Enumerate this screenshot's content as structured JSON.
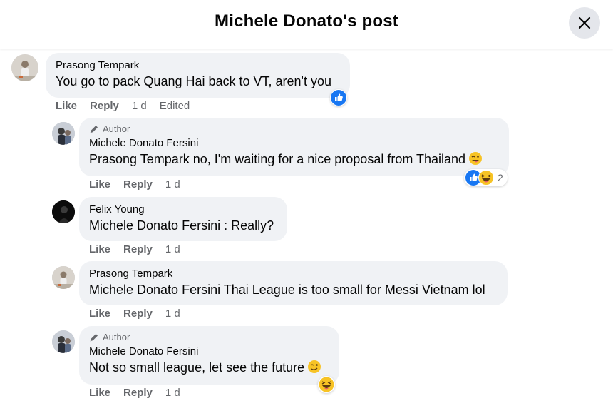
{
  "header": {
    "title": "Michele Donato's post"
  },
  "comments": [
    {
      "name": "Prasong Tempark",
      "text": "You go to pack Quang Hai back to VT, aren't you",
      "actions": {
        "like": "Like",
        "reply": "Reply",
        "time": "1 d",
        "edited": "Edited"
      }
    },
    {
      "author_tag": "Author",
      "name": "Michele Donato Fersini",
      "mention": "Prasong Tempark",
      "text": " no, I'm waiting for a nice proposal from Thailand",
      "reaction_count": "2",
      "actions": {
        "like": "Like",
        "reply": "Reply",
        "time": "1 d"
      }
    },
    {
      "name": "Felix Young",
      "mention": "Michele Donato Fersini",
      "text": " : Really?",
      "actions": {
        "like": "Like",
        "reply": "Reply",
        "time": "1 d"
      }
    },
    {
      "name": "Prasong Tempark",
      "mention": "Michele Donato Fersini",
      "text": " Thai League is too small for Messi Vietnam lol",
      "actions": {
        "like": "Like",
        "reply": "Reply",
        "time": "1 d"
      }
    },
    {
      "author_tag": "Author",
      "name": "Michele Donato Fersini",
      "text": "Not so small league, let see the future",
      "actions": {
        "like": "Like",
        "reply": "Reply",
        "time": "1 d"
      }
    }
  ],
  "colors": {
    "like_blue": "#1877f2",
    "bubble": "#f0f2f5",
    "muted": "#65676b"
  }
}
